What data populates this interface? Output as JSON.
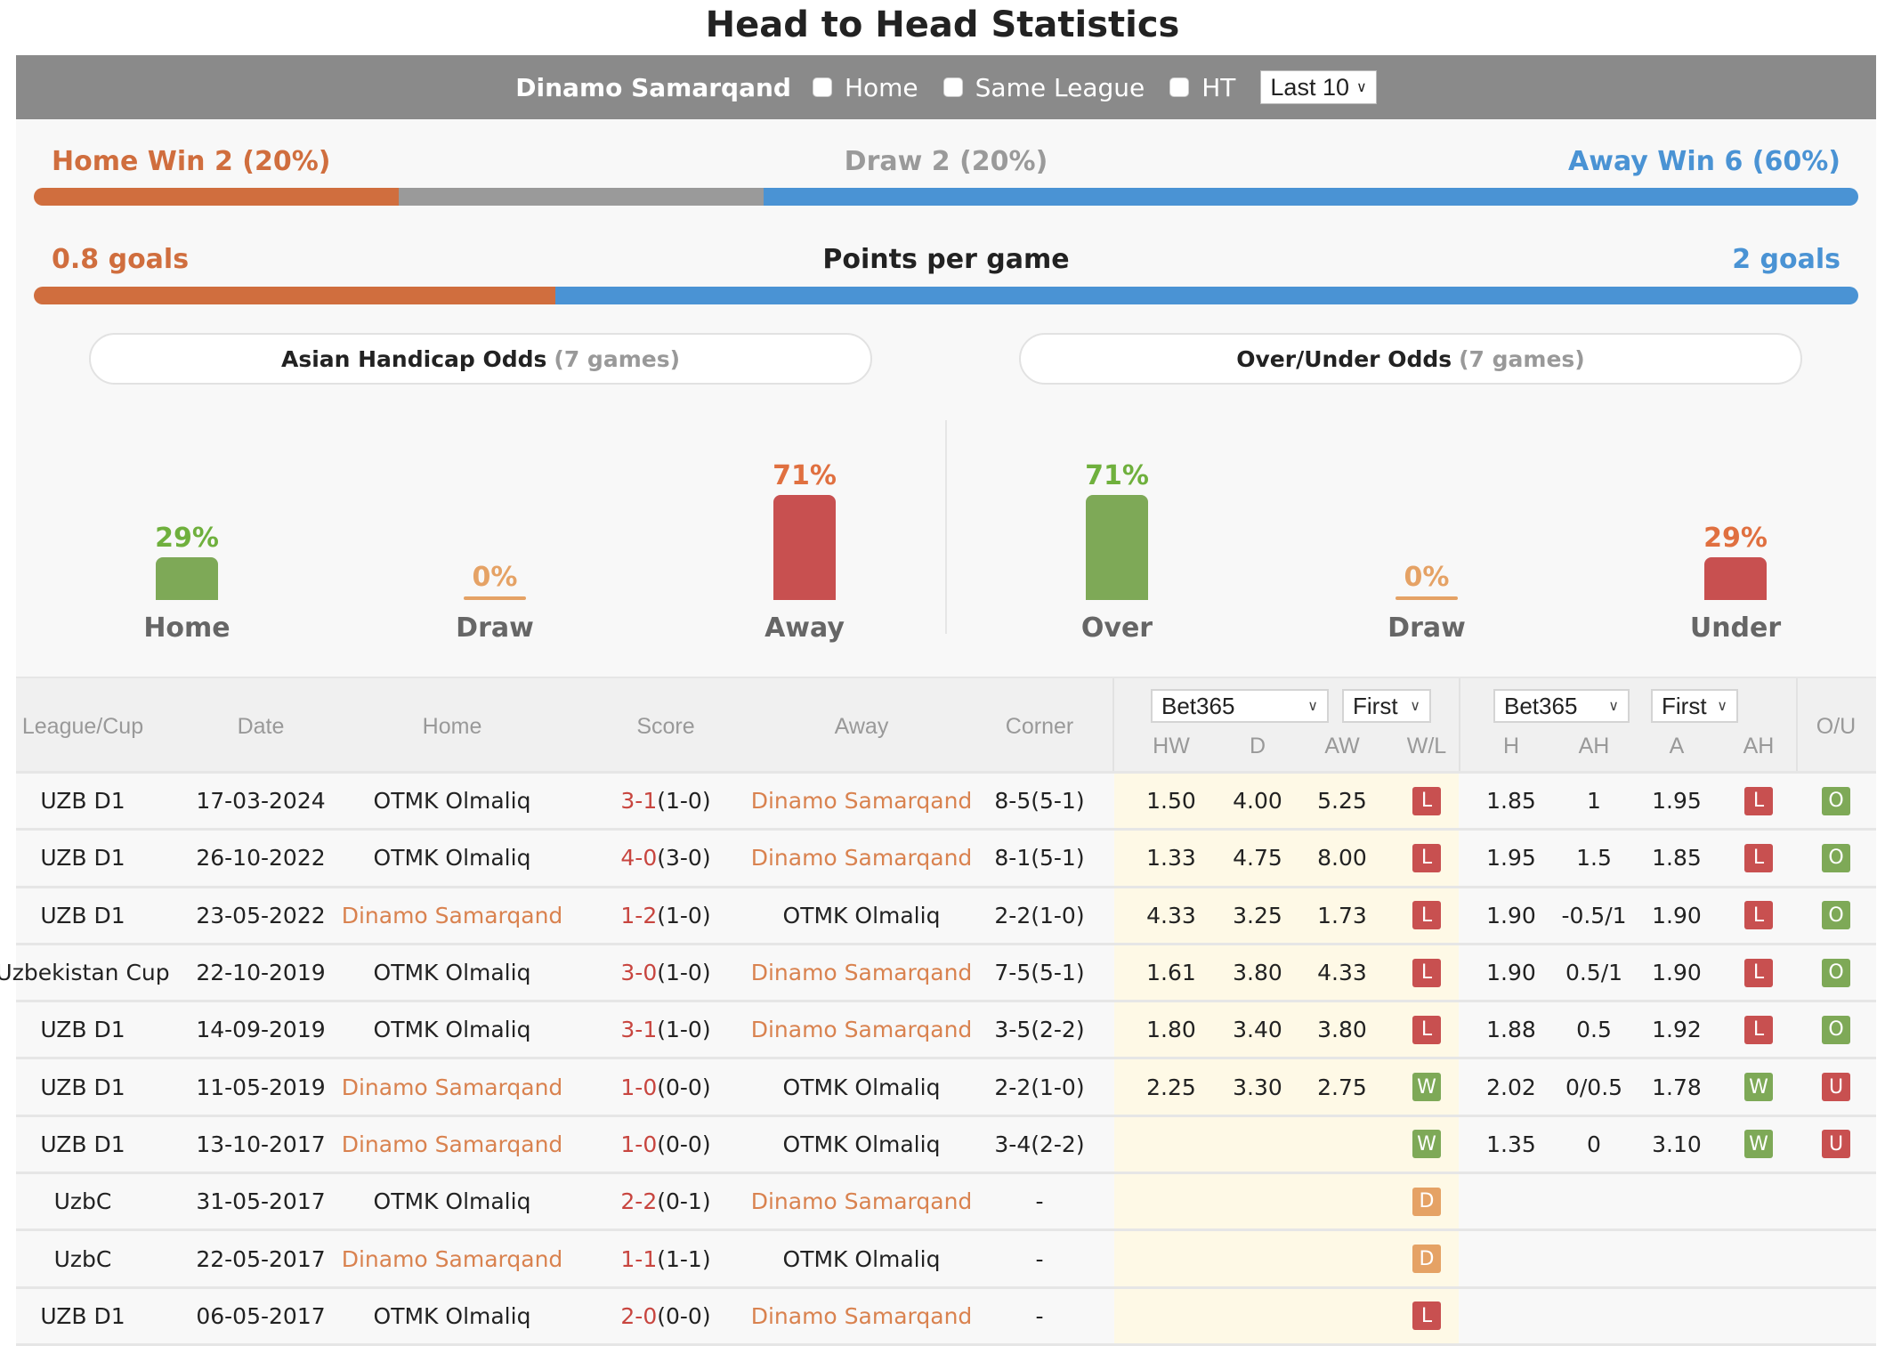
{
  "title": "Head to Head Statistics",
  "toolbar": {
    "team": "Dinamo Samarqand",
    "filters": [
      {
        "label": "Home",
        "checked": false
      },
      {
        "label": "Same League",
        "checked": false
      },
      {
        "label": "HT",
        "checked": false
      }
    ],
    "range_select": "Last 10"
  },
  "results": {
    "home_label": "Home Win 2 (20%)",
    "draw_label": "Draw 2 (20%)",
    "away_label": "Away Win 6 (60%)",
    "home_pct": 20,
    "draw_pct": 20,
    "away_pct": 60
  },
  "points_per_game": {
    "title": "Points per game",
    "home_label": "0.8 goals",
    "away_label": "2 goals",
    "home_value": 0.8,
    "away_value": 2
  },
  "asian_handicap": {
    "title": "Asian Handicap Odds",
    "games": "(7 games)",
    "items": [
      {
        "name": "Home",
        "pct_label": "29%",
        "pct": 29,
        "color": "#7ea957",
        "label_color": "#6fb03d"
      },
      {
        "name": "Draw",
        "pct_label": "0%",
        "pct": 0,
        "color": "#e5a265",
        "label_color": "#e5a265"
      },
      {
        "name": "Away",
        "pct_label": "71%",
        "pct": 71,
        "color": "#c85050",
        "label_color": "#e07040"
      }
    ]
  },
  "over_under": {
    "title": "Over/Under Odds",
    "games": "(7 games)",
    "items": [
      {
        "name": "Over",
        "pct_label": "71%",
        "pct": 71,
        "color": "#7ea957",
        "label_color": "#6fb03d"
      },
      {
        "name": "Draw",
        "pct_label": "0%",
        "pct": 0,
        "color": "#e5a265",
        "label_color": "#e5a265"
      },
      {
        "name": "Under",
        "pct_label": "29%",
        "pct": 29,
        "color": "#c85050",
        "label_color": "#e07040"
      }
    ]
  },
  "table": {
    "headers": {
      "league": "League/Cup",
      "date": "Date",
      "home": "Home",
      "score": "Score",
      "away": "Away",
      "corner": "Corner",
      "hw": "HW",
      "d": "D",
      "aw": "AW",
      "wl": "W/L",
      "h": "H",
      "ah": "AH",
      "a": "A",
      "ah2": "AH",
      "ou": "O/U"
    },
    "odds_company_1": "Bet365",
    "odds_type_1": "First",
    "odds_company_2": "Bet365",
    "odds_type_2": "First",
    "rows": [
      {
        "league": "UZB D1",
        "date": "17-03-2024",
        "home": "OTMK Olmaliq",
        "home_hl": false,
        "ft": "3-1",
        "ht": "(1-0)",
        "away": "Dinamo Samarqand",
        "away_hl": true,
        "corner": "8-5(5-1)",
        "hw": "1.50",
        "d": "4.00",
        "aw": "5.25",
        "wl": "L",
        "h": "1.85",
        "ah": "1",
        "a": "1.95",
        "ah_res": "L",
        "ou": "O"
      },
      {
        "league": "UZB D1",
        "date": "26-10-2022",
        "home": "OTMK Olmaliq",
        "home_hl": false,
        "ft": "4-0",
        "ht": "(3-0)",
        "away": "Dinamo Samarqand",
        "away_hl": true,
        "corner": "8-1(5-1)",
        "hw": "1.33",
        "d": "4.75",
        "aw": "8.00",
        "wl": "L",
        "h": "1.95",
        "ah": "1.5",
        "a": "1.85",
        "ah_res": "L",
        "ou": "O"
      },
      {
        "league": "UZB D1",
        "date": "23-05-2022",
        "home": "Dinamo Samarqand",
        "home_hl": true,
        "ft": "1-2",
        "ht": "(1-0)",
        "away": "OTMK Olmaliq",
        "away_hl": false,
        "corner": "2-2(1-0)",
        "hw": "4.33",
        "d": "3.25",
        "aw": "1.73",
        "wl": "L",
        "h": "1.90",
        "ah": "-0.5/1",
        "a": "1.90",
        "ah_res": "L",
        "ou": "O"
      },
      {
        "league": "Uzbekistan Cup",
        "date": "22-10-2019",
        "home": "OTMK Olmaliq",
        "home_hl": false,
        "ft": "3-0",
        "ht": "(1-0)",
        "away": "Dinamo Samarqand",
        "away_hl": true,
        "corner": "7-5(5-1)",
        "hw": "1.61",
        "d": "3.80",
        "aw": "4.33",
        "wl": "L",
        "h": "1.90",
        "ah": "0.5/1",
        "a": "1.90",
        "ah_res": "L",
        "ou": "O"
      },
      {
        "league": "UZB D1",
        "date": "14-09-2019",
        "home": "OTMK Olmaliq",
        "home_hl": false,
        "ft": "3-1",
        "ht": "(1-0)",
        "away": "Dinamo Samarqand",
        "away_hl": true,
        "corner": "3-5(2-2)",
        "hw": "1.80",
        "d": "3.40",
        "aw": "3.80",
        "wl": "L",
        "h": "1.88",
        "ah": "0.5",
        "a": "1.92",
        "ah_res": "L",
        "ou": "O"
      },
      {
        "league": "UZB D1",
        "date": "11-05-2019",
        "home": "Dinamo Samarqand",
        "home_hl": true,
        "ft": "1-0",
        "ht": "(0-0)",
        "away": "OTMK Olmaliq",
        "away_hl": false,
        "corner": "2-2(1-0)",
        "hw": "2.25",
        "d": "3.30",
        "aw": "2.75",
        "wl": "W",
        "h": "2.02",
        "ah": "0/0.5",
        "a": "1.78",
        "ah_res": "W",
        "ou": "U"
      },
      {
        "league": "UZB D1",
        "date": "13-10-2017",
        "home": "Dinamo Samarqand",
        "home_hl": true,
        "ft": "1-0",
        "ht": "(0-0)",
        "away": "OTMK Olmaliq",
        "away_hl": false,
        "corner": "3-4(2-2)",
        "hw": "",
        "d": "",
        "aw": "",
        "wl": "W",
        "h": "1.35",
        "ah": "0",
        "a": "3.10",
        "ah_res": "W",
        "ou": "U"
      },
      {
        "league": "UzbC",
        "date": "31-05-2017",
        "home": "OTMK Olmaliq",
        "home_hl": false,
        "ft": "2-2",
        "ht": "(0-1)",
        "away": "Dinamo Samarqand",
        "away_hl": true,
        "corner": "-",
        "hw": "",
        "d": "",
        "aw": "",
        "wl": "D",
        "h": "",
        "ah": "",
        "a": "",
        "ah_res": "",
        "ou": ""
      },
      {
        "league": "UzbC",
        "date": "22-05-2017",
        "home": "Dinamo Samarqand",
        "home_hl": true,
        "ft": "1-1",
        "ht": "(1-1)",
        "away": "OTMK Olmaliq",
        "away_hl": false,
        "corner": "-",
        "hw": "",
        "d": "",
        "aw": "",
        "wl": "D",
        "h": "",
        "ah": "",
        "a": "",
        "ah_res": "",
        "ou": ""
      },
      {
        "league": "UZB D1",
        "date": "06-05-2017",
        "home": "OTMK Olmaliq",
        "home_hl": false,
        "ft": "2-0",
        "ht": "(0-0)",
        "away": "Dinamo Samarqand",
        "away_hl": true,
        "corner": "-",
        "hw": "",
        "d": "",
        "aw": "",
        "wl": "L",
        "h": "",
        "ah": "",
        "a": "",
        "ah_res": "",
        "ou": ""
      }
    ]
  }
}
